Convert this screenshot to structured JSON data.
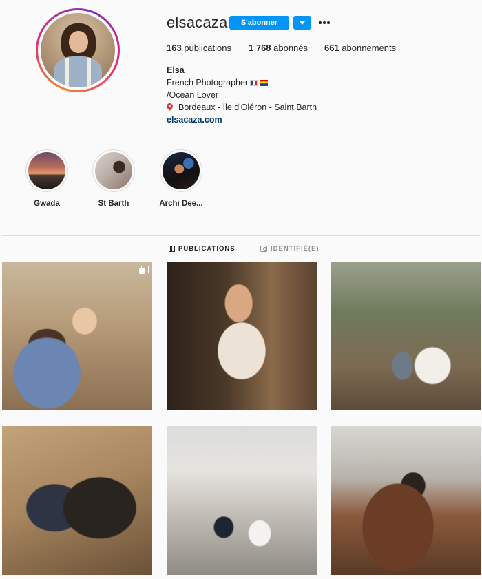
{
  "profile": {
    "username": "elsacaza",
    "follow_label": "S'abonner",
    "stats": {
      "publications_count": "163",
      "publications_label": "publications",
      "followers_count": "1 768",
      "followers_label": "abonnés",
      "following_count": "661",
      "following_label": "abonnements"
    },
    "bio": {
      "name": "Elsa",
      "line1": "French Photographer",
      "line2": "/Ocean Lover",
      "line3": "Bordeaux - Île d'Oléron - Saint Barth",
      "website": "elsacaza.com"
    }
  },
  "highlights": [
    {
      "label": "Gwada"
    },
    {
      "label": "St Barth"
    },
    {
      "label": "Archi Dee..."
    }
  ],
  "tabs": {
    "publications": "PUBLICATIONS",
    "tagged": "IDENTIFIÉ(E)"
  },
  "colors": {
    "accent": "#0095f6",
    "link": "#00376b",
    "text": "#262626",
    "muted": "#8e8e8e"
  },
  "icons": [
    "more-options-icon",
    "dropdown-arrow-icon",
    "location-pin-icon",
    "grid-icon",
    "tagged-icon",
    "carousel-icon"
  ]
}
